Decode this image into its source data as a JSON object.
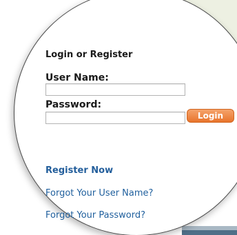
{
  "login_form": {
    "heading": "Login or Register",
    "username_label": "User Name:",
    "username_value": "",
    "password_label": "Password:",
    "password_value": "",
    "login_button": "Login"
  },
  "links": {
    "register": "Register Now",
    "forgot_username": "Forgot Your User Name?",
    "forgot_password": "Forgot Your Password?"
  },
  "colors": {
    "link": "#1f5f9d",
    "login_button": "#e8742c"
  }
}
